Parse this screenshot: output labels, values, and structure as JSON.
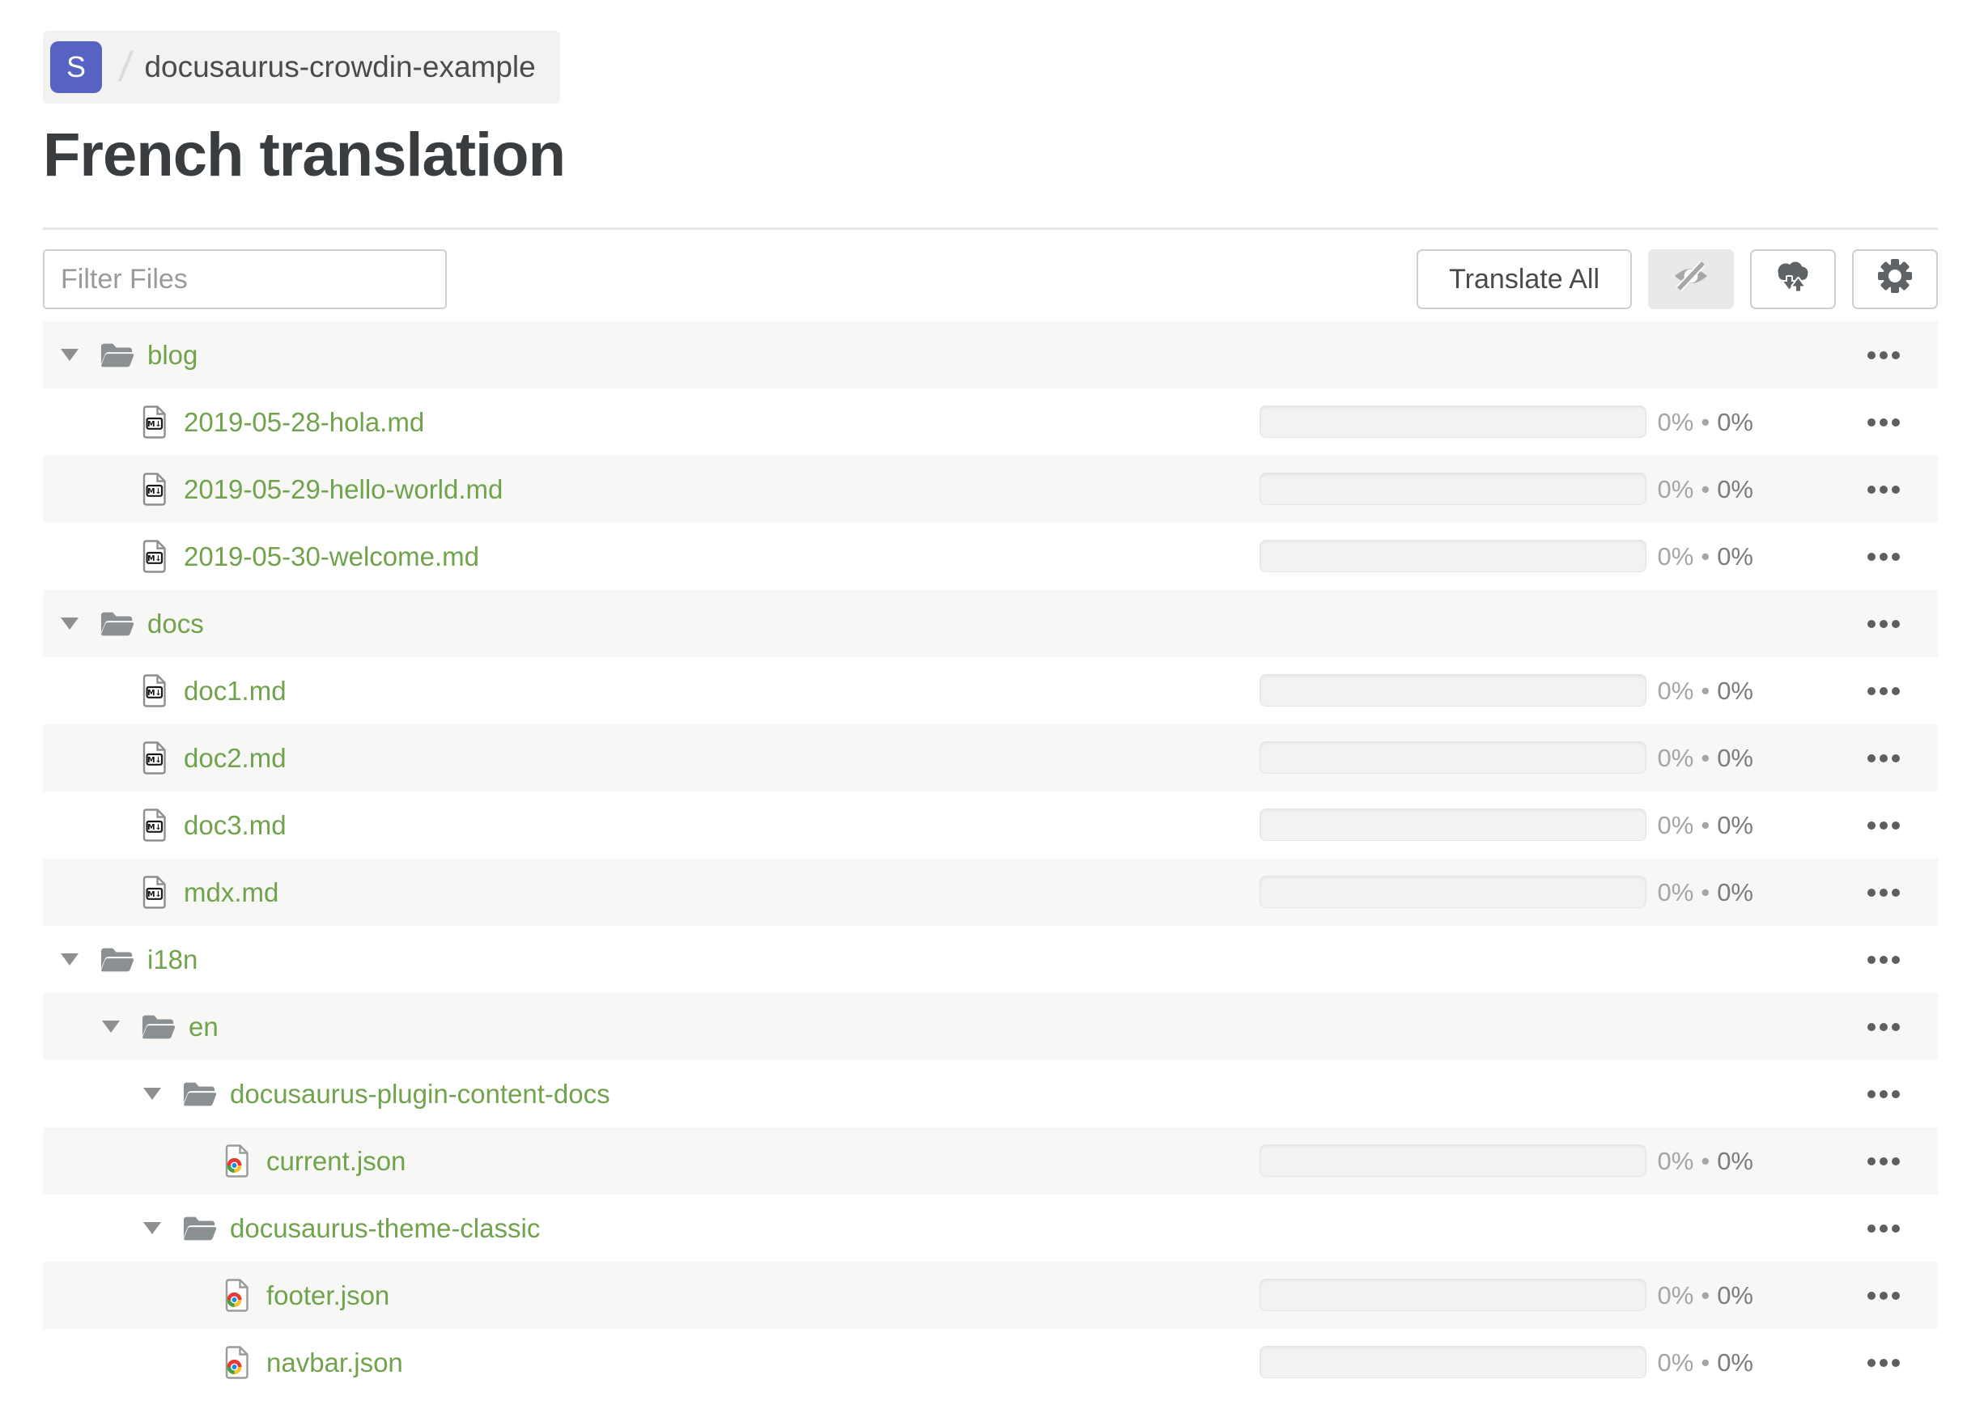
{
  "breadcrumb": {
    "avatar_letter": "S",
    "separator": "/",
    "project_name": "docusaurus-crowdin-example"
  },
  "page_title": "French translation",
  "toolbar": {
    "filter_placeholder": "Filter Files",
    "translate_all_label": "Translate All",
    "icon_buttons": [
      "eye-off",
      "cloud-sync",
      "gear"
    ]
  },
  "progress_format": {
    "separator": "•"
  },
  "colors": {
    "link_green": "#71a24c",
    "avatar_indigo": "#5763c3",
    "row_alt_bg": "#f7f7f5"
  },
  "tree": {
    "rows": [
      {
        "kind": "folder",
        "depth": 0,
        "label": "blog"
      },
      {
        "kind": "md",
        "depth": 1,
        "label": "2019-05-28-hola.md",
        "translated": "0%",
        "approved": "0%"
      },
      {
        "kind": "md",
        "depth": 1,
        "label": "2019-05-29-hello-world.md",
        "translated": "0%",
        "approved": "0%"
      },
      {
        "kind": "md",
        "depth": 1,
        "label": "2019-05-30-welcome.md",
        "translated": "0%",
        "approved": "0%"
      },
      {
        "kind": "folder",
        "depth": 0,
        "label": "docs"
      },
      {
        "kind": "md",
        "depth": 1,
        "label": "doc1.md",
        "translated": "0%",
        "approved": "0%"
      },
      {
        "kind": "md",
        "depth": 1,
        "label": "doc2.md",
        "translated": "0%",
        "approved": "0%"
      },
      {
        "kind": "md",
        "depth": 1,
        "label": "doc3.md",
        "translated": "0%",
        "approved": "0%"
      },
      {
        "kind": "md",
        "depth": 1,
        "label": "mdx.md",
        "translated": "0%",
        "approved": "0%"
      },
      {
        "kind": "folder",
        "depth": 0,
        "label": "i18n"
      },
      {
        "kind": "folder",
        "depth": 1,
        "label": "en"
      },
      {
        "kind": "folder",
        "depth": 2,
        "label": "docusaurus-plugin-content-docs"
      },
      {
        "kind": "json",
        "depth": 3,
        "label": "current.json",
        "translated": "0%",
        "approved": "0%"
      },
      {
        "kind": "folder",
        "depth": 2,
        "label": "docusaurus-theme-classic"
      },
      {
        "kind": "json",
        "depth": 3,
        "label": "footer.json",
        "translated": "0%",
        "approved": "0%"
      },
      {
        "kind": "json",
        "depth": 3,
        "label": "navbar.json",
        "translated": "0%",
        "approved": "0%"
      }
    ]
  }
}
